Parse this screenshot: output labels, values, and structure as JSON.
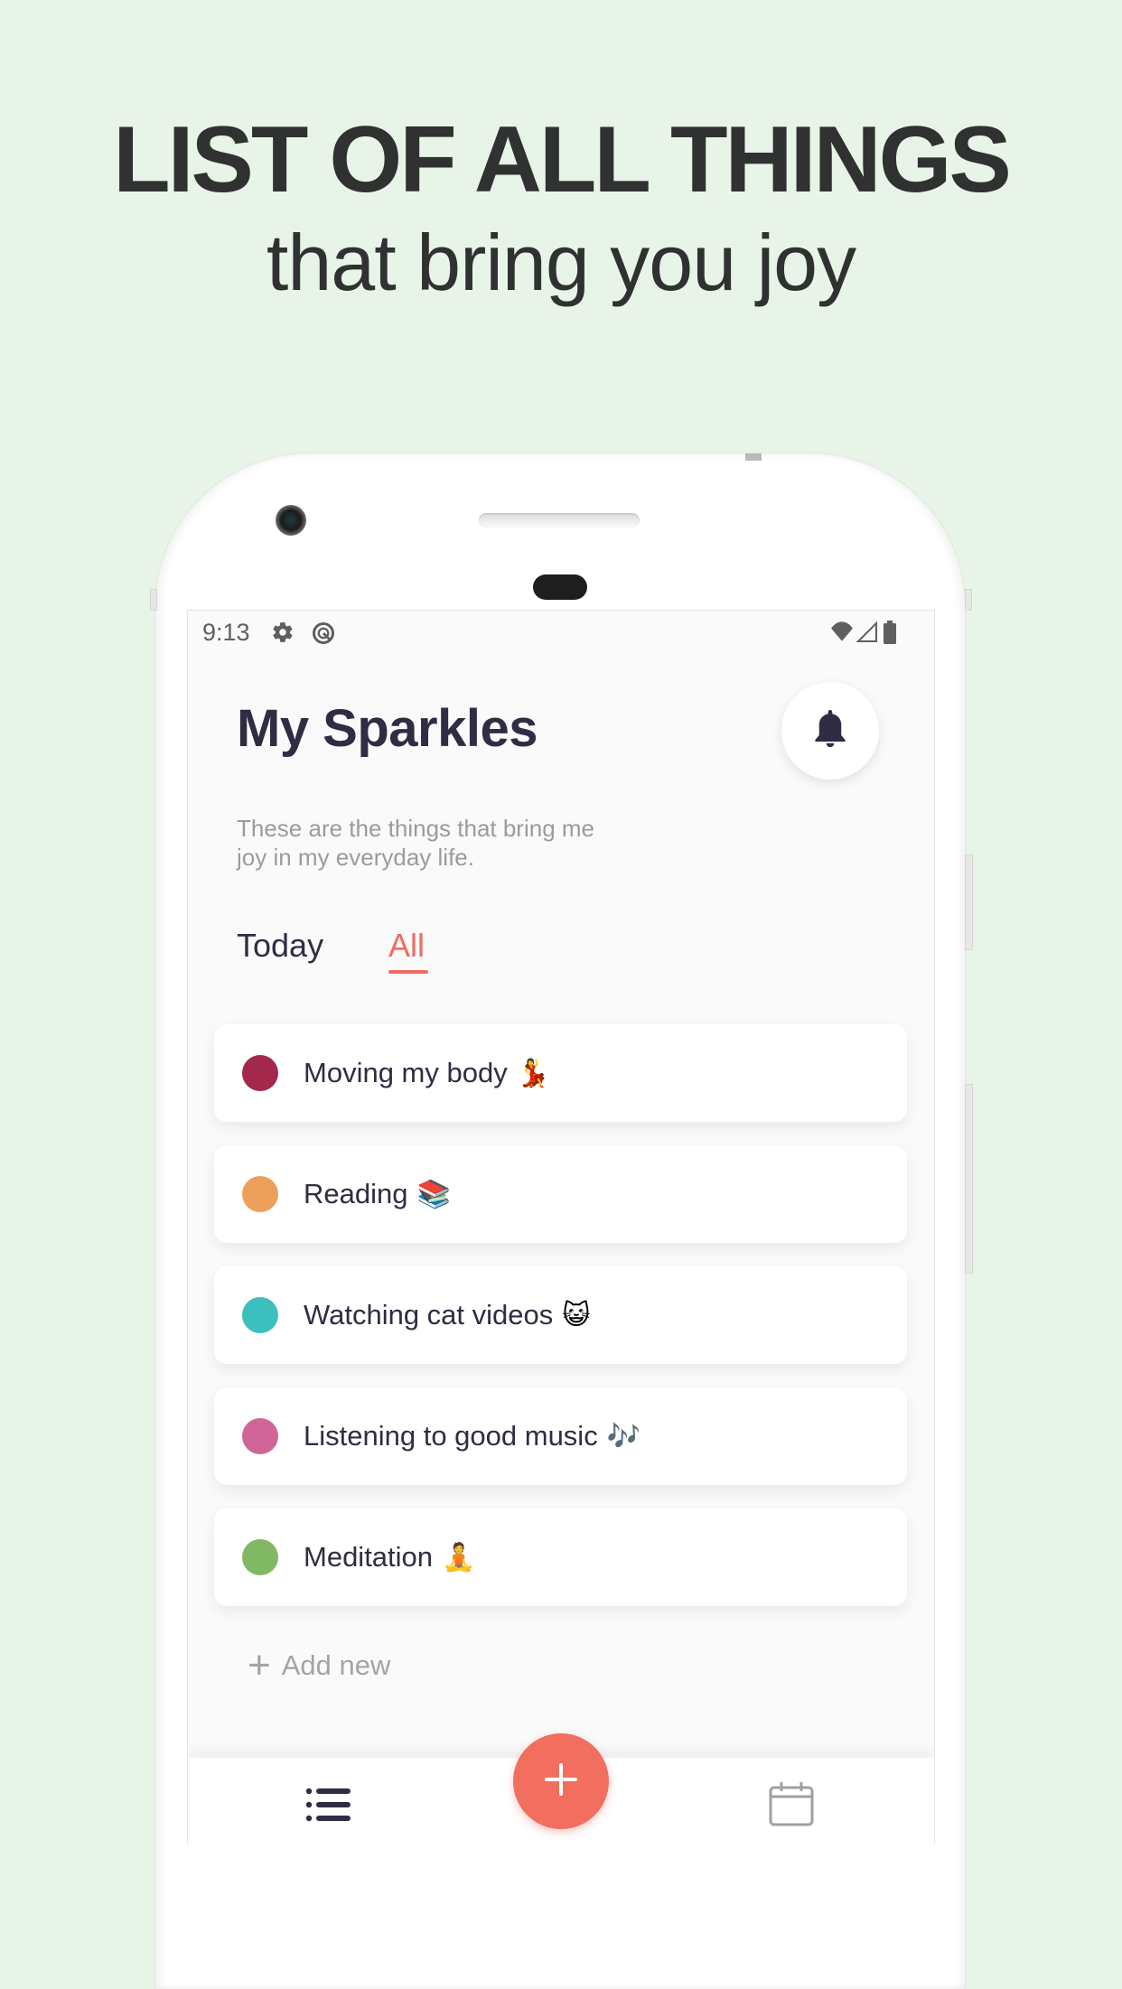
{
  "promo": {
    "headline": "LIST OF ALL THINGS",
    "subheadline": "that bring you joy",
    "background_color": "#e9f4e8"
  },
  "status_bar": {
    "time": "9:13",
    "left_icons": [
      "gear-icon",
      "data-saver-icon"
    ],
    "right_icons": [
      "wifi-icon",
      "signal-icon",
      "battery-icon"
    ]
  },
  "app": {
    "title": "My Sparkles",
    "subtitle": "These are the things that bring me joy in my everyday life.",
    "notification_icon": "bell-icon",
    "accent_color": "#f06c5f",
    "tabs": [
      {
        "label": "Today",
        "active": false
      },
      {
        "label": "All",
        "active": true
      }
    ],
    "items": [
      {
        "label": "Moving my body",
        "emoji": "💃",
        "color": "#a3284b"
      },
      {
        "label": "Reading",
        "emoji": "📚",
        "color": "#eda05a"
      },
      {
        "label": "Watching cat videos",
        "emoji": "😺",
        "color": "#3dbfbf"
      },
      {
        "label": "Listening to good music",
        "emoji": "🎶",
        "color": "#d06698"
      },
      {
        "label": "Meditation",
        "emoji": "🧘",
        "color": "#80b864"
      }
    ],
    "add_new_label": "Add new",
    "add_new_icon": "+",
    "bottom_nav": {
      "left_icon": "list-icon",
      "fab_icon": "plus-icon",
      "right_icon": "calendar-icon"
    }
  }
}
